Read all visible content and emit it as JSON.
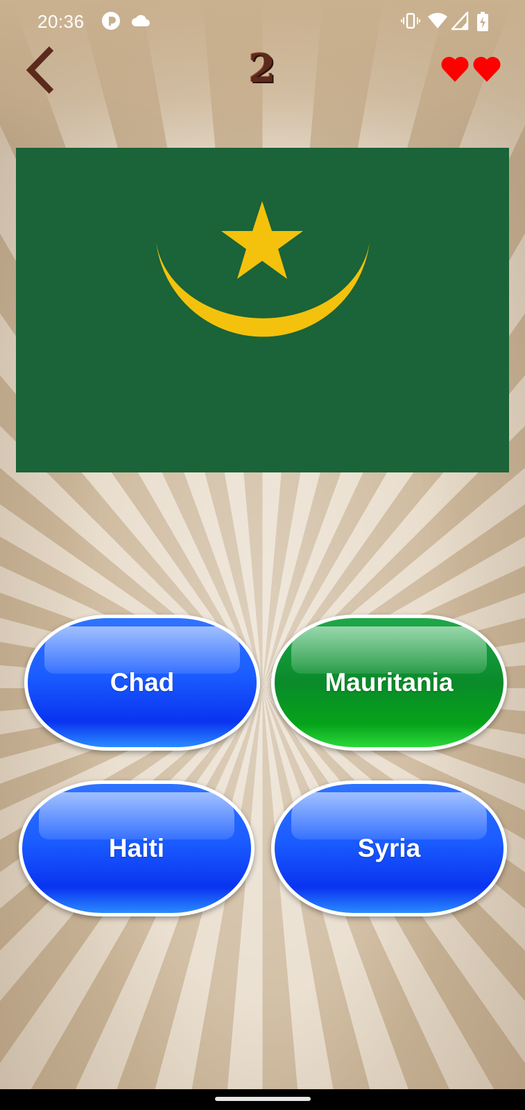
{
  "status_bar": {
    "time": "20:36",
    "icons": [
      "pocket-casts-icon",
      "cloud-icon",
      "vibrate-icon",
      "wifi-icon",
      "signal-icon",
      "battery-charging-icon"
    ]
  },
  "header": {
    "back_icon": "chevron-left-icon",
    "level": "2",
    "lives": 2,
    "life_icon": "heart-icon"
  },
  "flag": {
    "country_shown": "mauritania-flag",
    "colors": {
      "field": "#1b6338",
      "emblem": "#f4c20c"
    }
  },
  "answers": [
    {
      "label": "Chad",
      "state": "default"
    },
    {
      "label": "Mauritania",
      "state": "correct"
    },
    {
      "label": "Haiti",
      "state": "default"
    },
    {
      "label": "Syria",
      "state": "default"
    }
  ],
  "colors": {
    "answer_default": "#1a5cff",
    "answer_correct": "#0a8a2a",
    "heart": "#ff0000",
    "level_text": "#5b2a1c",
    "back_icon": "#5b2a1c"
  }
}
